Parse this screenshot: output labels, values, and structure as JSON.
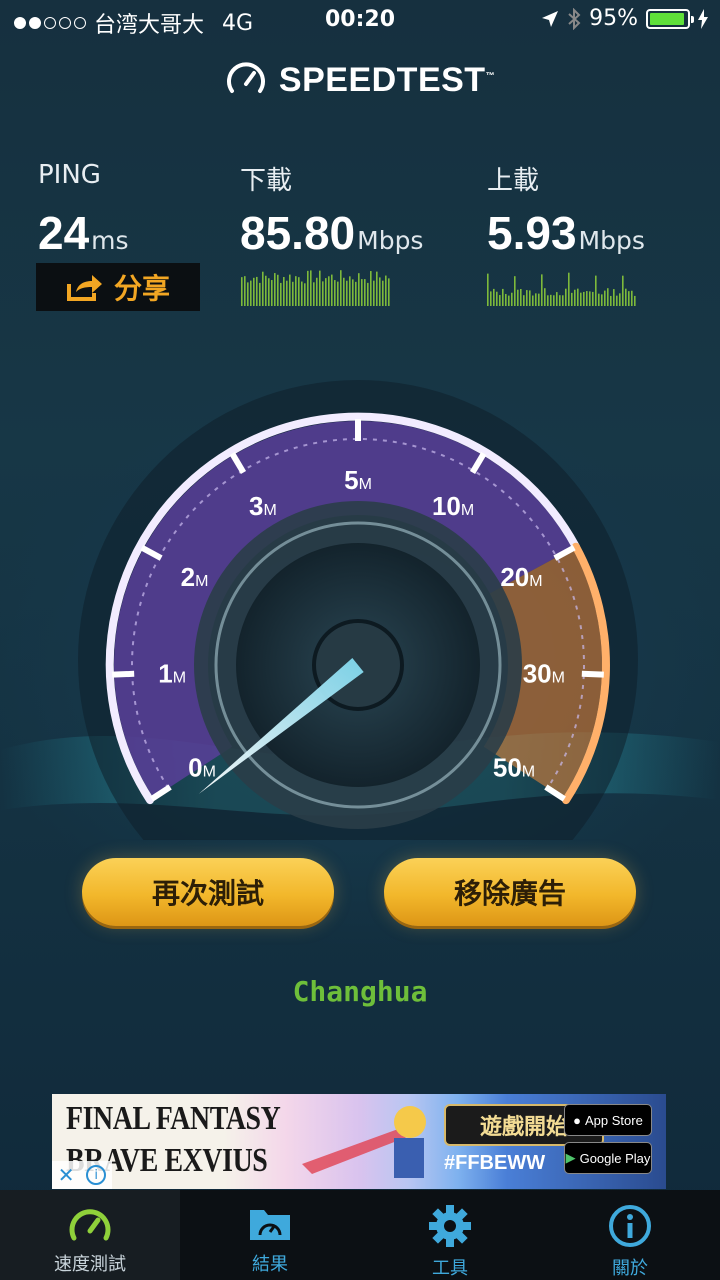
{
  "status_bar": {
    "carrier": "台湾大哥大",
    "network": "4G",
    "time": "00:20",
    "battery": "95%",
    "battery_level": 0.95
  },
  "header": {
    "title": "SPEEDTEST",
    "trademark": "™",
    "icon": "speedometer-icon"
  },
  "ping": {
    "label": "PING",
    "value": "24",
    "unit": "ms"
  },
  "download": {
    "label": "下載",
    "value": "85.80",
    "unit": "Mbps"
  },
  "upload": {
    "label": "上載",
    "value": "5.93",
    "unit": "Mbps"
  },
  "share_button": {
    "label": "分享",
    "icon": "share-icon"
  },
  "gauge": {
    "tick_labels": [
      {
        "n": "0",
        "u": "M"
      },
      {
        "n": "1",
        "u": "M"
      },
      {
        "n": "2",
        "u": "M"
      },
      {
        "n": "3",
        "u": "M"
      },
      {
        "n": "5",
        "u": "M"
      },
      {
        "n": "10",
        "u": "M"
      },
      {
        "n": "20",
        "u": "M"
      },
      {
        "n": "30",
        "u": "M"
      },
      {
        "n": "50",
        "u": "M"
      }
    ],
    "needle_value": "0",
    "colors": {
      "purple": "#5a3f9a",
      "orange": "#f08a3a",
      "needle": "#bff4ff"
    }
  },
  "buttons": {
    "retest": "再次測試",
    "remove_ads": "移除廣告"
  },
  "location": "Changhua",
  "ad": {
    "title_line1": "FINAL FANTASY",
    "title_line2": "BRAVE EXVIUS",
    "play_label": "遊戲開始",
    "hashtag": "#FFBEWW",
    "app_store": "App Store",
    "google_play": "Google Play"
  },
  "tabs": [
    {
      "label": "速度測試",
      "icon": "speedometer-icon",
      "active": true
    },
    {
      "label": "結果",
      "icon": "results-folder-icon",
      "active": false
    },
    {
      "label": "工具",
      "icon": "gear-icon",
      "active": false
    },
    {
      "label": "關於",
      "icon": "info-icon",
      "active": false
    }
  ]
}
